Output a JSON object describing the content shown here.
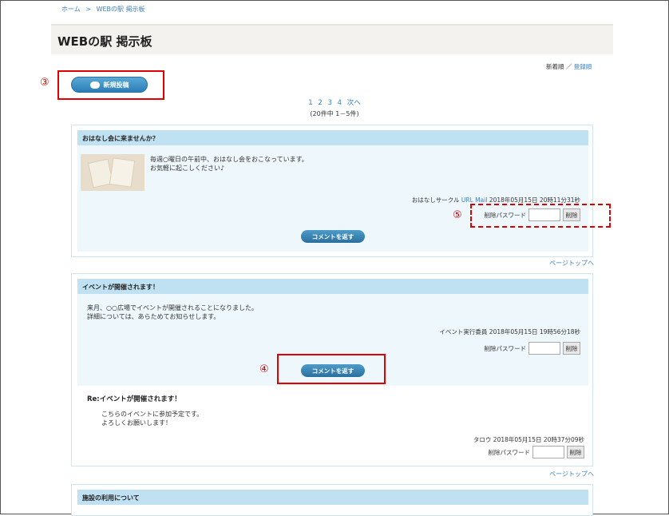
{
  "breadcrumb": {
    "home": "ホーム",
    "sep": ">",
    "current": "WEBの駅 掲示板"
  },
  "page_title": "WEBの駅 掲示板",
  "sort": {
    "newest": "新着順",
    "sep": "／",
    "registered": "登録順"
  },
  "markers": {
    "m3": "③",
    "m4": "④",
    "m5": "⑤"
  },
  "new_post_label": "新規投稿",
  "pager": {
    "p1": "1",
    "p2": "2",
    "p3": "3",
    "p4": "4",
    "next": "次へ",
    "count": "(20件中 1－5件)"
  },
  "delete_password_label": "削除パスワード",
  "delete_button": "削除",
  "reply_button": "コメントを返す",
  "page_top": "ページトップへ",
  "posts": [
    {
      "title": "おはなし会に来ませんか？",
      "body": "毎週○曜日の午前中、おはなし会をおこなっています。\nお気軽に起こしください♪",
      "author": "おはなしサークル",
      "url_label": "URL",
      "mail_label": "Mail",
      "date": "2018年05月15日 20時11分31秒"
    },
    {
      "title": "イベントが開催されます！",
      "body": "来月、○○広場でイベントが開催されることになりました。\n詳細については、あらためてお知らせします。",
      "author": "イベント実行委員",
      "date": "2018年05月15日 19時56分18秒",
      "reply": {
        "title": "Re:イベントが開催されます！",
        "body": "こちらのイベントに参加予定です。\nよろしくお願いします！",
        "author": "タロウ",
        "date": "2018年05月15日 20時37分09秒"
      }
    },
    {
      "title": "施設の利用について"
    }
  ],
  "colors": {
    "accent": "#3a7fc0",
    "header_band": "#bfe1f1",
    "body_band": "#eef7fc",
    "annotation": "#e10000"
  }
}
